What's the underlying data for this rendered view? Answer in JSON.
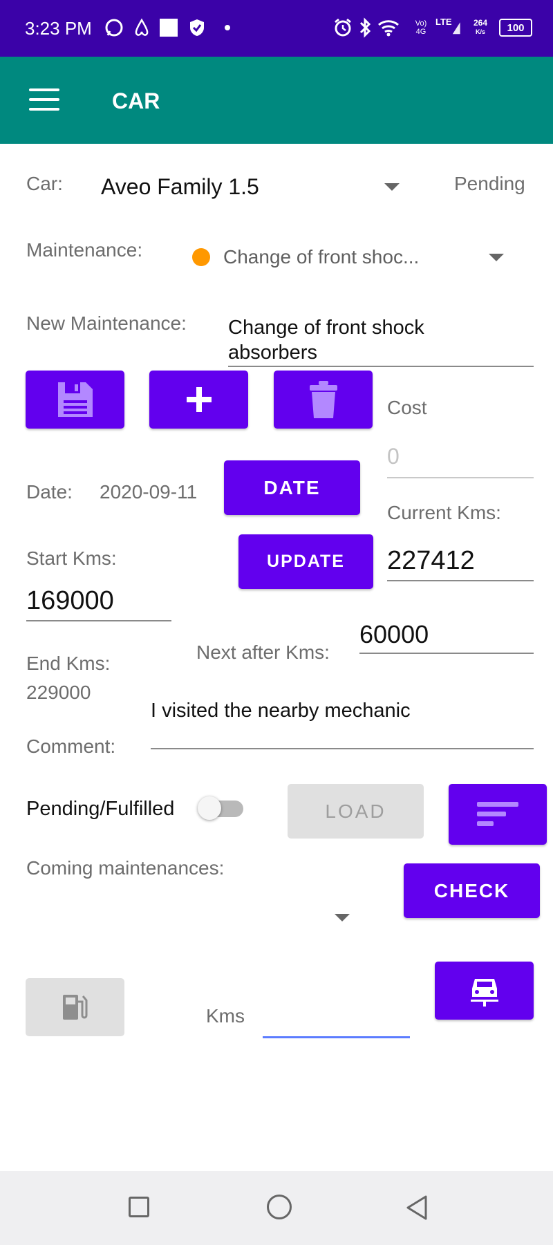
{
  "status_bar": {
    "time": "3:23 PM",
    "network_label": "Vo) 4G",
    "lte_label": "LTE",
    "speed_value": "264",
    "speed_unit": "K/s",
    "battery": "100"
  },
  "app_bar": {
    "title": "CAR"
  },
  "car": {
    "label": "Car:",
    "selected": "Aveo Family 1.5",
    "status": "Pending"
  },
  "maintenance": {
    "label": "Maintenance:",
    "selected": "Change of front shoc...",
    "status_dot_color": "#ff9800"
  },
  "new_maintenance": {
    "label": "New Maintenance:",
    "value_line1": "Change of front shock",
    "value_line2": "absorbers"
  },
  "cost": {
    "label": "Cost",
    "placeholder": "0"
  },
  "date": {
    "label": "Date:",
    "value": "2020-09-11",
    "button": "DATE"
  },
  "current_kms": {
    "label": "Current Kms:",
    "value": "227412"
  },
  "start_kms": {
    "label": "Start Kms:",
    "value": "169000"
  },
  "update_button": "UPDATE",
  "next_after": {
    "label": "Next after Kms:",
    "value": "60000"
  },
  "end_kms": {
    "label": "End Kms:",
    "value": "229000"
  },
  "comment": {
    "label": "Comment:",
    "value": "I visited the nearby mechanic"
  },
  "pending_toggle": {
    "label": "Pending/Fulfilled",
    "checked": false
  },
  "load_button": "LOAD",
  "coming": {
    "label": "Coming maintenances:"
  },
  "check_button": "CHECK",
  "kms_input": {
    "label": "Kms",
    "value": ""
  },
  "colors": {
    "primary": "#6200ee",
    "app_bar": "#00897f",
    "status_bar": "#3b02a8"
  }
}
